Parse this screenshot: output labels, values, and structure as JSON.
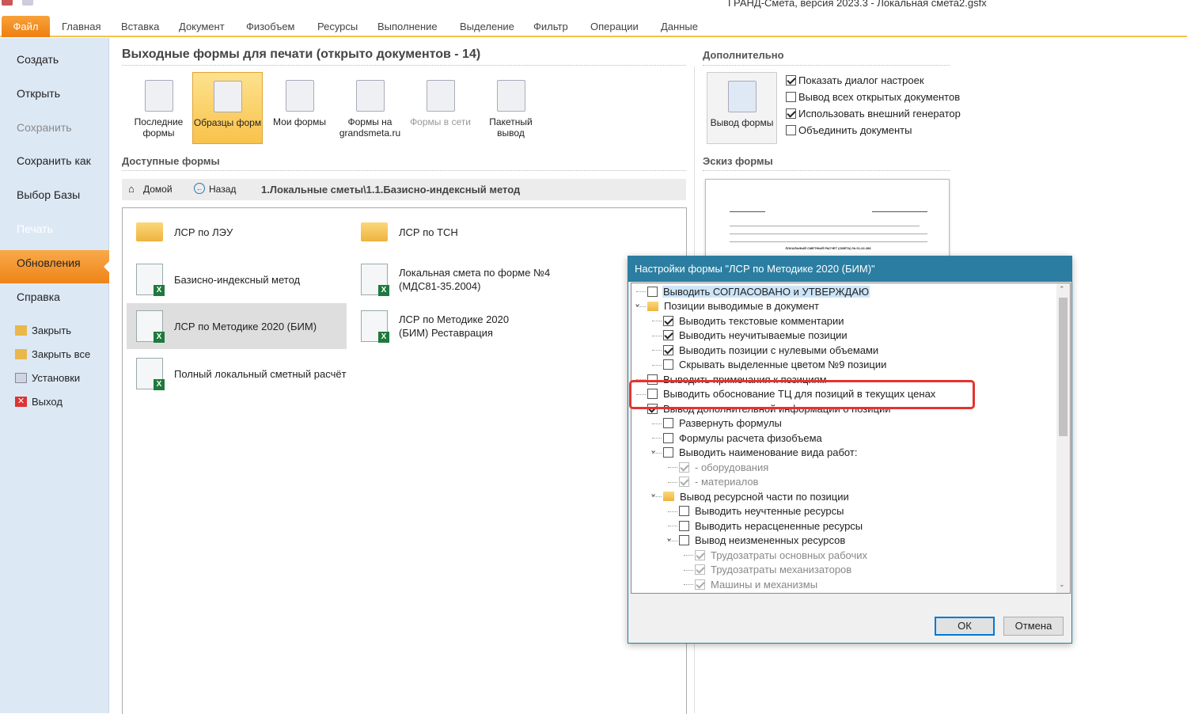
{
  "window": {
    "title": "ГРАНД-Смета, версия 2023.3 - Локальная смета2.gsfx"
  },
  "tabs": [
    "Файл",
    "Главная",
    "Вставка",
    "Документ",
    "Физобъем",
    "Ресурсы",
    "Выполнение",
    "Выделение",
    "Фильтр",
    "Операции",
    "Данные"
  ],
  "sidebar": {
    "items": [
      "Создать",
      "Открыть",
      "Сохранить",
      "Сохранить как",
      "Выбор Базы",
      "Печать",
      "Обновления",
      "Справка"
    ],
    "small": [
      "Закрыть",
      "Закрыть все",
      "Установки",
      "Выход"
    ]
  },
  "main": {
    "title": "Выходные формы для печати (открыто документов - 14)",
    "buttons": [
      "Последние формы",
      "Образцы форм",
      "Мои формы",
      "Формы на grandsmeta.ru",
      "Формы в сети",
      "Пакетный вывод"
    ],
    "available_title": "Доступные формы",
    "nav": {
      "home": "Домой",
      "back": "Назад",
      "path": "1.Локальные сметы\\1.1.Базисно-индексный метод"
    },
    "forms": [
      "ЛСР по ЛЭУ",
      "ЛСР по ТСН",
      "Базисно-индексный метод",
      "Локальная смета по форме №4 (МДС81-35.2004)",
      "ЛСР по Методике 2020 (БИМ)",
      "ЛСР по Методике 2020 (БИМ) Реставрация",
      "Полный локальный сметный расчёт"
    ]
  },
  "extra": {
    "title": "Дополнительно",
    "button": "Вывод формы",
    "options": [
      {
        "label": "Показать диалог настроек",
        "checked": true
      },
      {
        "label": "Вывод всех открытых документов",
        "checked": false
      },
      {
        "label": "Использовать внешний генератор",
        "checked": true
      },
      {
        "label": "Объединить документы",
        "checked": false
      }
    ],
    "preview_title": "Эскиз формы",
    "preview_text": "ЛОКАЛЬНЫЙ СМЕТНЫЙ РАСЧЕТ (СМЕТА) № 01-22-286"
  },
  "dialog": {
    "title": "Настройки формы \"ЛСР по Методике 2020 (БИМ)\"",
    "ok": "ОК",
    "cancel": "Отмена",
    "tree": [
      {
        "level": 0,
        "label": "Выводить СОГЛАСОВАНО и УТВЕРЖДАЮ",
        "type": "check",
        "checked": false,
        "highlight": true
      },
      {
        "level": 0,
        "label": "Позиции выводимые в документ",
        "type": "folder",
        "expanded": true
      },
      {
        "level": 1,
        "label": "Выводить текстовые комментарии",
        "type": "check",
        "checked": true
      },
      {
        "level": 1,
        "label": "Выводить неучитываемые позиции",
        "type": "check",
        "checked": true
      },
      {
        "level": 1,
        "label": "Выводить позиции с нулевыми объемами",
        "type": "check",
        "checked": true
      },
      {
        "level": 1,
        "label": "Скрывать выделенные цветом №9 позиции",
        "type": "check",
        "checked": false
      },
      {
        "level": 0,
        "label": "Выводить примечания к позициям",
        "type": "check",
        "checked": false
      },
      {
        "level": 0,
        "label": "Выводить обоснование ТЦ для позиций в текущих ценах",
        "type": "check",
        "checked": false
      },
      {
        "level": 0,
        "label": "Вывод дополнительной информации о позиции",
        "type": "check",
        "checked": true
      },
      {
        "level": 1,
        "label": "Развернуть формулы",
        "type": "check",
        "checked": false
      },
      {
        "level": 1,
        "label": "Формулы расчета физобъема",
        "type": "check",
        "checked": false
      },
      {
        "level": 1,
        "label": "Выводить наименование вида работ:",
        "type": "check",
        "checked": false,
        "expanded": true
      },
      {
        "level": 2,
        "label": "- оборудования",
        "type": "check",
        "checked": true,
        "disabled": true
      },
      {
        "level": 2,
        "label": "- материалов",
        "type": "check",
        "checked": true,
        "disabled": true
      },
      {
        "level": 1,
        "label": "Вывод ресурсной части по позиции",
        "type": "folder",
        "expanded": true
      },
      {
        "level": 2,
        "label": "Выводить неучтенные ресурсы",
        "type": "check",
        "checked": false
      },
      {
        "level": 2,
        "label": "Выводить нерасцененные ресурсы",
        "type": "check",
        "checked": false
      },
      {
        "level": 2,
        "label": "Вывод неизмененных ресурсов",
        "type": "check",
        "checked": false,
        "expanded": true
      },
      {
        "level": 3,
        "label": "Трудозатраты основных рабочих",
        "type": "check",
        "checked": true,
        "disabled": true
      },
      {
        "level": 3,
        "label": "Трудозатраты механизаторов",
        "type": "check",
        "checked": true,
        "disabled": true
      },
      {
        "level": 3,
        "label": "Машины и механизмы",
        "type": "check",
        "checked": true,
        "disabled": true
      }
    ]
  }
}
